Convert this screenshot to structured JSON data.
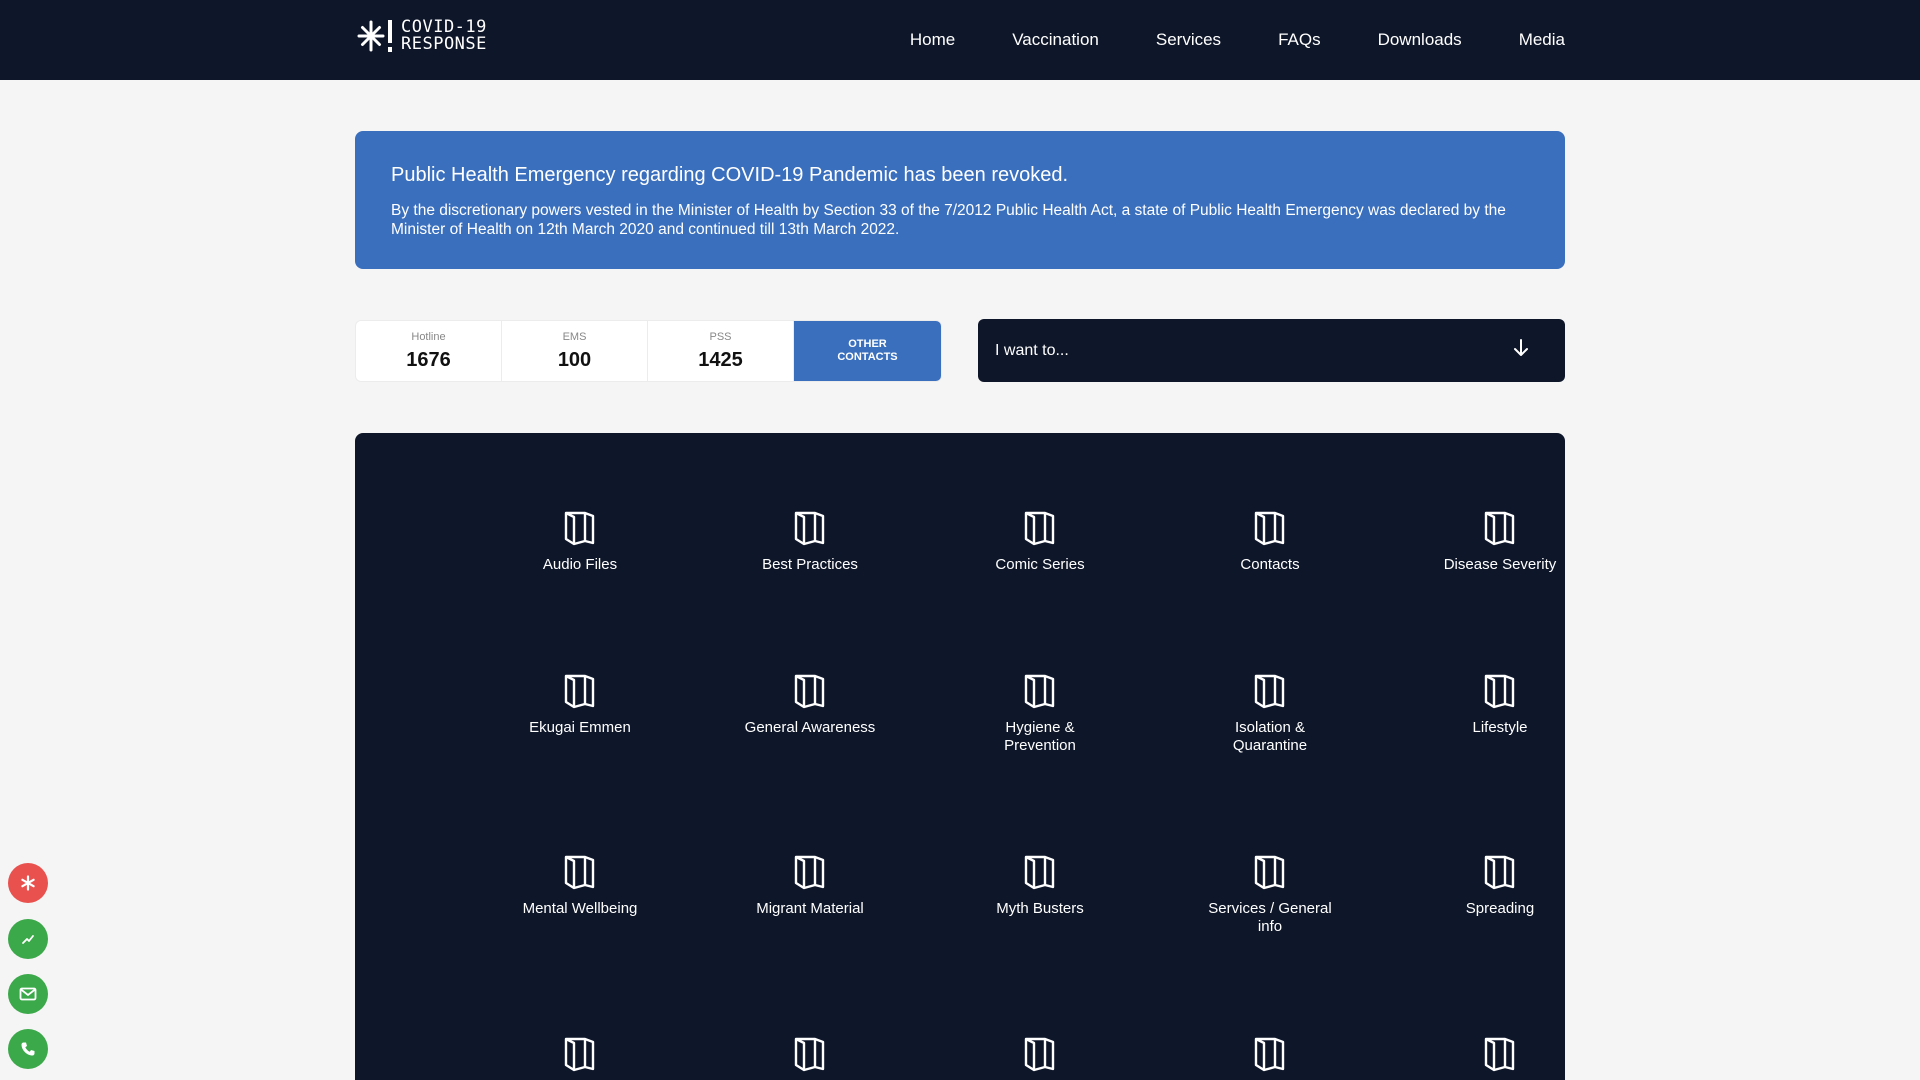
{
  "brand": {
    "line1": "COVID-19",
    "line2": "RESPONSE"
  },
  "nav": [
    "Home",
    "Vaccination",
    "Services",
    "FAQs",
    "Downloads",
    "Media"
  ],
  "alert": {
    "title": "Public Health Emergency regarding COVID-19 Pandemic has been revoked.",
    "body": "By the discretionary powers vested in the Minister of Health by Section 33 of the 7/2012 Public Health Act, a state of Public Health Emergency was declared by the Minister of Health on 12th March 2020 and continued till 13th March 2022."
  },
  "contacts": [
    {
      "label": "Hotline",
      "value": "1676"
    },
    {
      "label": "EMS",
      "value": "100"
    },
    {
      "label": "PSS",
      "value": "1425"
    }
  ],
  "other_contacts": {
    "line1": "OTHER",
    "line2": "CONTACTS"
  },
  "want_to": "I want to...",
  "categories": [
    "Audio Files",
    "Best Practices",
    "Comic Series",
    "Contacts",
    "Disease Severity",
    "Ekugai Emmen",
    "General Awareness",
    "Hygiene & Prevention",
    "Isolation & Quarantine",
    "Lifestyle",
    "Mental Wellbeing",
    "Migrant Material",
    "Myth Busters",
    "Services / General info",
    "Spreading",
    "",
    "",
    "",
    "",
    ""
  ],
  "colors": {
    "navy": "#0e1629",
    "blue": "#3a6fbe",
    "side_red": "#e9514e",
    "side_green": "#3ba84a"
  },
  "side_buttons": [
    "asterisk-icon",
    "graph-icon",
    "mail-icon",
    "phone-icon"
  ]
}
